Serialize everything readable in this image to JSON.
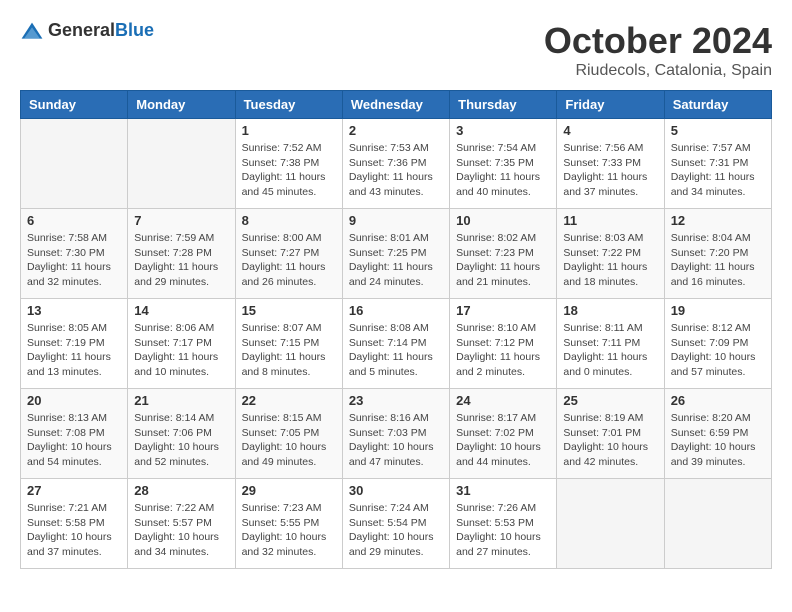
{
  "header": {
    "logo_general": "General",
    "logo_blue": "Blue",
    "month_year": "October 2024",
    "location": "Riudecols, Catalonia, Spain"
  },
  "weekdays": [
    "Sunday",
    "Monday",
    "Tuesday",
    "Wednesday",
    "Thursday",
    "Friday",
    "Saturday"
  ],
  "weeks": [
    [
      {
        "day": "",
        "info": ""
      },
      {
        "day": "",
        "info": ""
      },
      {
        "day": "1",
        "info": "Sunrise: 7:52 AM\nSunset: 7:38 PM\nDaylight: 11 hours and 45 minutes."
      },
      {
        "day": "2",
        "info": "Sunrise: 7:53 AM\nSunset: 7:36 PM\nDaylight: 11 hours and 43 minutes."
      },
      {
        "day": "3",
        "info": "Sunrise: 7:54 AM\nSunset: 7:35 PM\nDaylight: 11 hours and 40 minutes."
      },
      {
        "day": "4",
        "info": "Sunrise: 7:56 AM\nSunset: 7:33 PM\nDaylight: 11 hours and 37 minutes."
      },
      {
        "day": "5",
        "info": "Sunrise: 7:57 AM\nSunset: 7:31 PM\nDaylight: 11 hours and 34 minutes."
      }
    ],
    [
      {
        "day": "6",
        "info": "Sunrise: 7:58 AM\nSunset: 7:30 PM\nDaylight: 11 hours and 32 minutes."
      },
      {
        "day": "7",
        "info": "Sunrise: 7:59 AM\nSunset: 7:28 PM\nDaylight: 11 hours and 29 minutes."
      },
      {
        "day": "8",
        "info": "Sunrise: 8:00 AM\nSunset: 7:27 PM\nDaylight: 11 hours and 26 minutes."
      },
      {
        "day": "9",
        "info": "Sunrise: 8:01 AM\nSunset: 7:25 PM\nDaylight: 11 hours and 24 minutes."
      },
      {
        "day": "10",
        "info": "Sunrise: 8:02 AM\nSunset: 7:23 PM\nDaylight: 11 hours and 21 minutes."
      },
      {
        "day": "11",
        "info": "Sunrise: 8:03 AM\nSunset: 7:22 PM\nDaylight: 11 hours and 18 minutes."
      },
      {
        "day": "12",
        "info": "Sunrise: 8:04 AM\nSunset: 7:20 PM\nDaylight: 11 hours and 16 minutes."
      }
    ],
    [
      {
        "day": "13",
        "info": "Sunrise: 8:05 AM\nSunset: 7:19 PM\nDaylight: 11 hours and 13 minutes."
      },
      {
        "day": "14",
        "info": "Sunrise: 8:06 AM\nSunset: 7:17 PM\nDaylight: 11 hours and 10 minutes."
      },
      {
        "day": "15",
        "info": "Sunrise: 8:07 AM\nSunset: 7:15 PM\nDaylight: 11 hours and 8 minutes."
      },
      {
        "day": "16",
        "info": "Sunrise: 8:08 AM\nSunset: 7:14 PM\nDaylight: 11 hours and 5 minutes."
      },
      {
        "day": "17",
        "info": "Sunrise: 8:10 AM\nSunset: 7:12 PM\nDaylight: 11 hours and 2 minutes."
      },
      {
        "day": "18",
        "info": "Sunrise: 8:11 AM\nSunset: 7:11 PM\nDaylight: 11 hours and 0 minutes."
      },
      {
        "day": "19",
        "info": "Sunrise: 8:12 AM\nSunset: 7:09 PM\nDaylight: 10 hours and 57 minutes."
      }
    ],
    [
      {
        "day": "20",
        "info": "Sunrise: 8:13 AM\nSunset: 7:08 PM\nDaylight: 10 hours and 54 minutes."
      },
      {
        "day": "21",
        "info": "Sunrise: 8:14 AM\nSunset: 7:06 PM\nDaylight: 10 hours and 52 minutes."
      },
      {
        "day": "22",
        "info": "Sunrise: 8:15 AM\nSunset: 7:05 PM\nDaylight: 10 hours and 49 minutes."
      },
      {
        "day": "23",
        "info": "Sunrise: 8:16 AM\nSunset: 7:03 PM\nDaylight: 10 hours and 47 minutes."
      },
      {
        "day": "24",
        "info": "Sunrise: 8:17 AM\nSunset: 7:02 PM\nDaylight: 10 hours and 44 minutes."
      },
      {
        "day": "25",
        "info": "Sunrise: 8:19 AM\nSunset: 7:01 PM\nDaylight: 10 hours and 42 minutes."
      },
      {
        "day": "26",
        "info": "Sunrise: 8:20 AM\nSunset: 6:59 PM\nDaylight: 10 hours and 39 minutes."
      }
    ],
    [
      {
        "day": "27",
        "info": "Sunrise: 7:21 AM\nSunset: 5:58 PM\nDaylight: 10 hours and 37 minutes."
      },
      {
        "day": "28",
        "info": "Sunrise: 7:22 AM\nSunset: 5:57 PM\nDaylight: 10 hours and 34 minutes."
      },
      {
        "day": "29",
        "info": "Sunrise: 7:23 AM\nSunset: 5:55 PM\nDaylight: 10 hours and 32 minutes."
      },
      {
        "day": "30",
        "info": "Sunrise: 7:24 AM\nSunset: 5:54 PM\nDaylight: 10 hours and 29 minutes."
      },
      {
        "day": "31",
        "info": "Sunrise: 7:26 AM\nSunset: 5:53 PM\nDaylight: 10 hours and 27 minutes."
      },
      {
        "day": "",
        "info": ""
      },
      {
        "day": "",
        "info": ""
      }
    ]
  ]
}
